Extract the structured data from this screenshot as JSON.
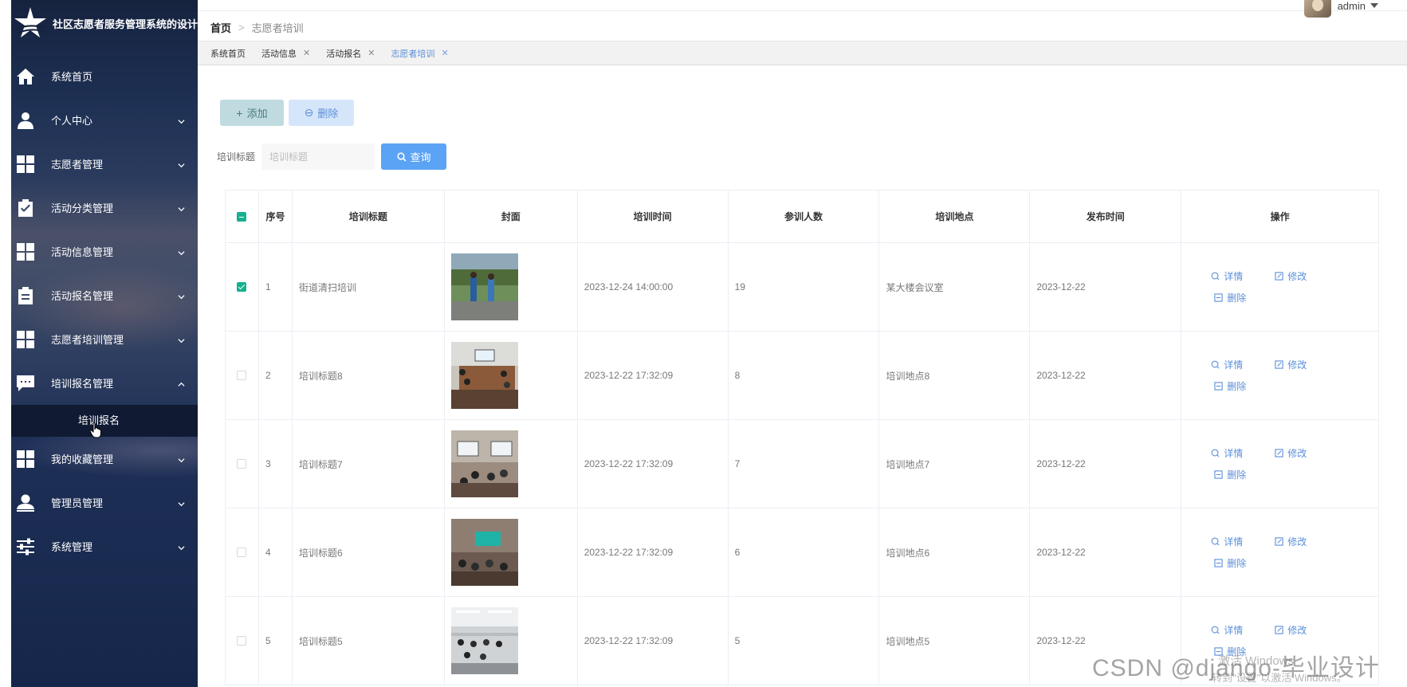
{
  "app": {
    "title": "社区志愿者服务管理系统的设计与"
  },
  "sidebar": {
    "items": [
      {
        "label": "系统首页",
        "icon": "home-icon"
      },
      {
        "label": "个人中心",
        "icon": "user-icon"
      },
      {
        "label": "志愿者管理",
        "icon": "grid-icon"
      },
      {
        "label": "活动分类管理",
        "icon": "clipboard-check-icon"
      },
      {
        "label": "活动信息管理",
        "icon": "grid-icon"
      },
      {
        "label": "活动报名管理",
        "icon": "clipboard-icon"
      },
      {
        "label": "志愿者培训管理",
        "icon": "grid-icon"
      },
      {
        "label": "培训报名管理",
        "icon": "chat-icon"
      },
      {
        "label": "我的收藏管理",
        "icon": "grid-icon"
      },
      {
        "label": "管理员管理",
        "icon": "admin-user-icon"
      },
      {
        "label": "系统管理",
        "icon": "sliders-icon"
      }
    ],
    "submenu": {
      "label": "培训报名"
    }
  },
  "header": {
    "breadcrumb": {
      "home": "首页",
      "separator": ">",
      "current": "志愿者培训"
    },
    "user": {
      "name": "admin"
    }
  },
  "tags": [
    {
      "label": "系统首页",
      "closable": false
    },
    {
      "label": "活动信息",
      "closable": true
    },
    {
      "label": "活动报名",
      "closable": true
    },
    {
      "label": "志愿者培训",
      "closable": true,
      "active": true
    }
  ],
  "toolbar": {
    "add_label": "添加",
    "delete_label": "删除"
  },
  "search": {
    "label": "培训标题",
    "placeholder": "培训标题",
    "button_label": "查询"
  },
  "table": {
    "headers": [
      "序号",
      "培训标题",
      "封面",
      "培训时间",
      "参训人数",
      "培训地点",
      "发布时间",
      "操作"
    ],
    "row_actions": {
      "detail": "详情",
      "edit": "修改",
      "delete": "删除"
    },
    "rows": [
      {
        "index": "1",
        "title": "街道清扫培训",
        "time": "2023-12-24 14:00:00",
        "count": "19",
        "location": "某大楼会议室",
        "published": "2023-12-22",
        "checked": true
      },
      {
        "index": "2",
        "title": "培训标题8",
        "time": "2023-12-22 17:32:09",
        "count": "8",
        "location": "培训地点8",
        "published": "2023-12-22",
        "checked": false
      },
      {
        "index": "3",
        "title": "培训标题7",
        "time": "2023-12-22 17:32:09",
        "count": "7",
        "location": "培训地点7",
        "published": "2023-12-22",
        "checked": false
      },
      {
        "index": "4",
        "title": "培训标题6",
        "time": "2023-12-22 17:32:09",
        "count": "6",
        "location": "培训地点6",
        "published": "2023-12-22",
        "checked": false
      },
      {
        "index": "5",
        "title": "培训标题5",
        "time": "2023-12-22 17:32:09",
        "count": "5",
        "location": "培训地点5",
        "published": "2023-12-22",
        "checked": false
      }
    ]
  },
  "overlay": {
    "watermark": "CSDN @django-毕业设计",
    "windows_activate_1": "激活 Windows",
    "windows_activate_2": "转到\"设置\"以激活 Windows。"
  },
  "colors": {
    "accent": "#5ba3f5",
    "link": "#5b8fd9",
    "checkbox": "#16b08f",
    "add_button_bg": "#bfdbe0",
    "delete_button_bg": "#d6e6fa"
  }
}
